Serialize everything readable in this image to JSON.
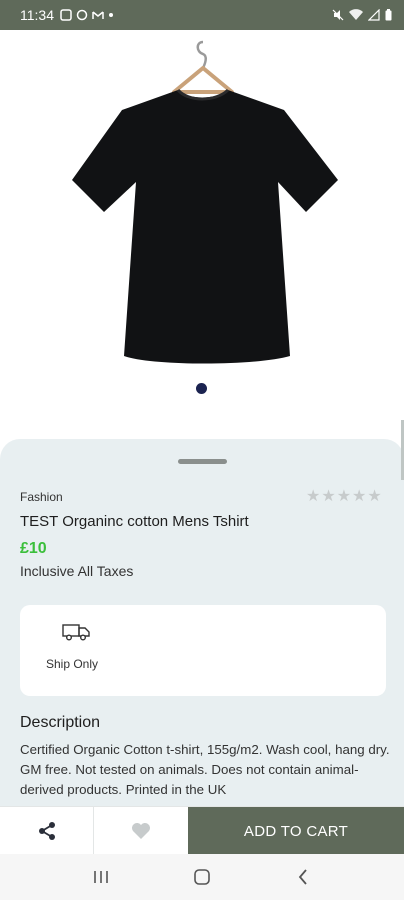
{
  "status_bar": {
    "time": "11:34",
    "left_icons": [
      "notification-icon",
      "whatsapp-icon",
      "gmail-icon",
      "dot-icon"
    ],
    "right_icons": [
      "mute-icon",
      "wifi-icon",
      "signal-icon",
      "battery-icon"
    ]
  },
  "product": {
    "category": "Fashion",
    "title": "TEST Organinc cotton Mens Tshirt",
    "price": "£10",
    "tax_note": "Inclusive All Taxes",
    "rating": 0,
    "rating_max": 5,
    "image_count": 1,
    "image_index": 1
  },
  "shipping": {
    "label": "Ship Only",
    "icon": "truck-icon"
  },
  "description": {
    "heading": "Description",
    "text": "Certified Organic Cotton t-shirt, 155g/m2. Wash cool, hang dry. GM free. Not tested on animals. Does not contain animal-derived products. Printed in the UK"
  },
  "actions": {
    "share_icon": "share-icon",
    "wishlist_icon": "heart-icon",
    "add_to_cart": "ADD TO CART"
  },
  "nav": {
    "icons": [
      "recents-icon",
      "home-icon",
      "back-icon"
    ]
  },
  "colors": {
    "accent": "#5f6a5a",
    "price": "#3bbf3b",
    "sheet": "#e8eff1"
  }
}
